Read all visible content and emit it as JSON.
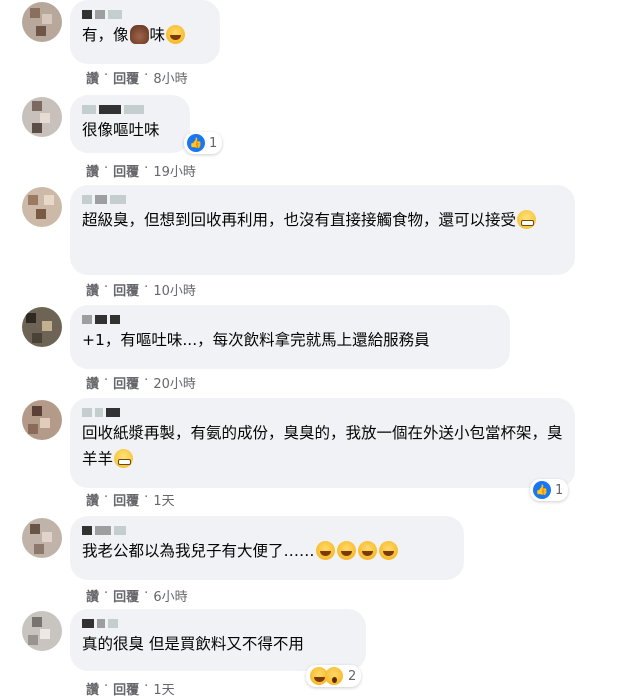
{
  "actions": {
    "like": "讚",
    "reply": "回覆",
    "dot": "·"
  },
  "comments": [
    {
      "text": "有，像",
      "text_after": "味",
      "time": "8小時"
    },
    {
      "text": "很像嘔吐味",
      "time": "19小時",
      "reactions": {
        "count": "1",
        "icon": "like-icon"
      }
    },
    {
      "text": "超級臭，但想到回收再利用，也沒有直接接觸食物，還可以接受",
      "time": "10小時"
    },
    {
      "text": "+1，有嘔吐味...，每次飲料拿完就馬上還給服務員",
      "time": "20小時"
    },
    {
      "text": "回收紙漿再製，有氨的成份，臭臭的，我放一個在外送小包當杯架，臭羊羊",
      "time": "1天",
      "reactions": {
        "count": "1",
        "icon": "like-icon"
      }
    },
    {
      "text": "我老公都以為我兒子有大便了……",
      "time": "6小時"
    },
    {
      "text": "真的很臭 但是買飲料又不得不用",
      "time": "1天",
      "reactions": {
        "count": "2",
        "icon": "laugh-wow-icon"
      }
    }
  ],
  "colors": {
    "bubble": "#f0f2f5",
    "meta": "#65676b",
    "like": "#1877f2"
  }
}
